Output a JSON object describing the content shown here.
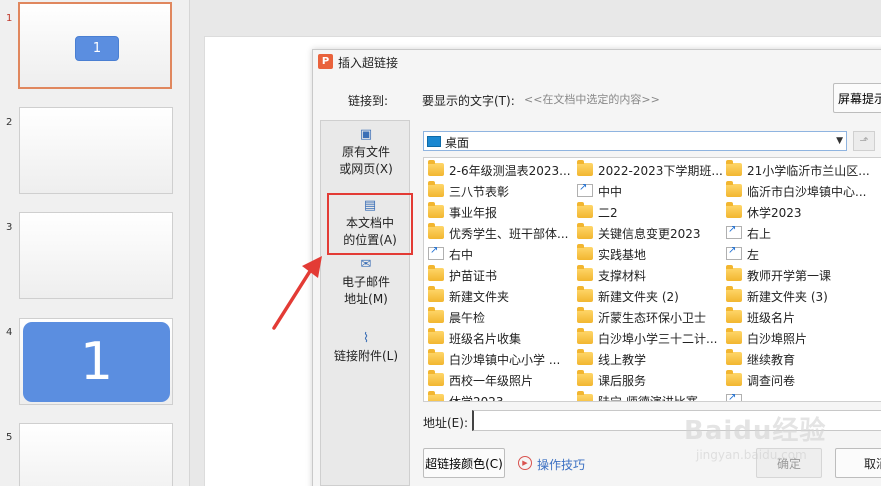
{
  "thumbnails": [
    {
      "num": "1",
      "content": "1"
    },
    {
      "num": "2",
      "content": ""
    },
    {
      "num": "3",
      "content": ""
    },
    {
      "num": "4",
      "content": "1"
    },
    {
      "num": "5",
      "content": ""
    }
  ],
  "dialog": {
    "title": "插入超链接",
    "link_to_label": "链接到:",
    "display_text_label": "要显示的文字(T):",
    "display_text_value": "<<在文档中选定的内容>>",
    "screentip_button": "屏幕提示",
    "link_options": [
      {
        "line1": "原有文件",
        "line2": "或网页(X)",
        "icon": "globe-file-icon"
      },
      {
        "line1": "本文档中",
        "line2": "的位置(A)",
        "icon": "document-place-icon"
      },
      {
        "line1": "电子邮件",
        "line2": "地址(M)",
        "icon": "email-icon"
      },
      {
        "line1": "链接附件(L)",
        "line2": "",
        "icon": "paperclip-icon"
      }
    ],
    "folder": "桌面",
    "files": [
      {
        "name": "2-6年级测温表2023...",
        "type": "folder"
      },
      {
        "name": "2022-2023下学期班...",
        "type": "folder"
      },
      {
        "name": "21小学临沂市兰山区...",
        "type": "folder"
      },
      {
        "name": "三八节表彰",
        "type": "folder"
      },
      {
        "name": "中中",
        "type": "shortcut"
      },
      {
        "name": "临沂市白沙埠镇中心...",
        "type": "folder"
      },
      {
        "name": "事业年报",
        "type": "folder"
      },
      {
        "name": "二2",
        "type": "folder"
      },
      {
        "name": "休学2023",
        "type": "folder"
      },
      {
        "name": "优秀学生、班干部体...",
        "type": "folder"
      },
      {
        "name": "关键信息变更2023",
        "type": "folder"
      },
      {
        "name": "右上",
        "type": "shortcut"
      },
      {
        "name": "右中",
        "type": "shortcut"
      },
      {
        "name": "实践基地",
        "type": "folder"
      },
      {
        "name": "左",
        "type": "shortcut"
      },
      {
        "name": "护苗证书",
        "type": "folder"
      },
      {
        "name": "支撑材料",
        "type": "folder"
      },
      {
        "name": "教师开学第一课",
        "type": "folder"
      },
      {
        "name": "新建文件夹",
        "type": "folder"
      },
      {
        "name": "新建文件夹 (2)",
        "type": "folder"
      },
      {
        "name": "新建文件夹 (3)",
        "type": "folder"
      },
      {
        "name": "晨午检",
        "type": "folder"
      },
      {
        "name": "沂蒙生态环保小卫士",
        "type": "folder"
      },
      {
        "name": "班级名片",
        "type": "folder"
      },
      {
        "name": "班级名片收集",
        "type": "folder"
      },
      {
        "name": "白沙埠小学三十二计...",
        "type": "folder"
      },
      {
        "name": "白沙埠照片",
        "type": "folder"
      },
      {
        "name": "白沙埠镇中心小学  ...",
        "type": "folder"
      },
      {
        "name": "线上教学",
        "type": "folder"
      },
      {
        "name": "继续教育",
        "type": "folder"
      },
      {
        "name": "西校一年级照片",
        "type": "folder"
      },
      {
        "name": "课后服务",
        "type": "folder"
      },
      {
        "name": "调查问卷",
        "type": "folder"
      },
      {
        "name": "休学2023",
        "type": "folder"
      },
      {
        "name": "陆宁 师德演讲比赛",
        "type": "folder"
      },
      {
        "name": "",
        "type": "shortcut"
      }
    ],
    "address_label": "地址(E):",
    "address_value": "",
    "color_button": "超链接颜色(C)",
    "tips_link": "操作技巧",
    "ok_button": "确定",
    "cancel_button": "取消"
  },
  "watermark": {
    "main": "Baidu经验",
    "sub": "jingyan.baidu.com"
  },
  "colors": {
    "accent_blue": "#5b8ee0",
    "highlight_red": "#e33b35",
    "folder_yellow": "#f2b630",
    "link_blue": "#3a6fc2"
  }
}
